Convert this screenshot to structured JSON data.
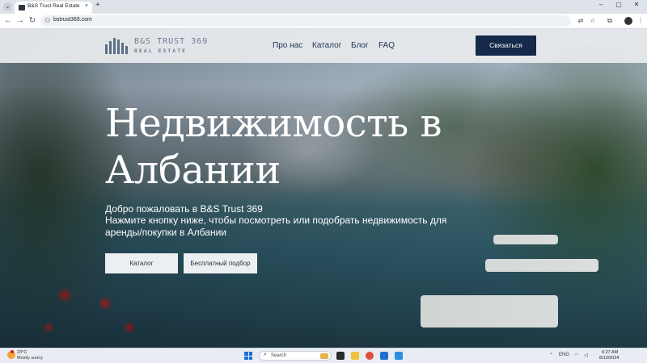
{
  "browser": {
    "tab_title": "B&S Trust Real Estate",
    "tab_close": "×",
    "new_tab": "+",
    "tab_list": "⌄",
    "url": "bstrust369.com",
    "back": "←",
    "forward": "→",
    "reload": "↻",
    "site_info": "⚇",
    "window_minimize": "–",
    "window_maximize": "▢",
    "window_close": "✕",
    "translate_icon": "⇄",
    "bookmark_icon": "☆",
    "extensions_icon": "⧉",
    "menu_icon": "⋮"
  },
  "site": {
    "logo_name": "B&S TRUST 369",
    "logo_sub": "REAL ESTATE",
    "nav": [
      "Про нас",
      "Каталог",
      "Блог",
      "FAQ"
    ],
    "contact_button": "Связаться"
  },
  "hero": {
    "title": "Недвижимость в Албании",
    "welcome": "Добро пожаловать в B&S Trust 369",
    "description": "Нажмите кнопку ниже, чтобы посмотреть или подобрать недвижимость для аренды/покупки в Албании",
    "catalog_button": "Каталог",
    "free_pick_button": "Бесплатный подбор"
  },
  "taskbar": {
    "temperature": "23°C",
    "weather": "Mostly sunny",
    "search_placeholder": "Search",
    "search_glyph": "⌕",
    "language": "ENG",
    "tray_icons": "⌃",
    "wifi_icon": "◠",
    "volume_icon": "◁",
    "time": "6:27 AM",
    "date": "8/13/2024"
  },
  "colors": {
    "nav_text": "#1f3352",
    "contact_button": "#152a4a",
    "logo": "#6c7e93"
  }
}
